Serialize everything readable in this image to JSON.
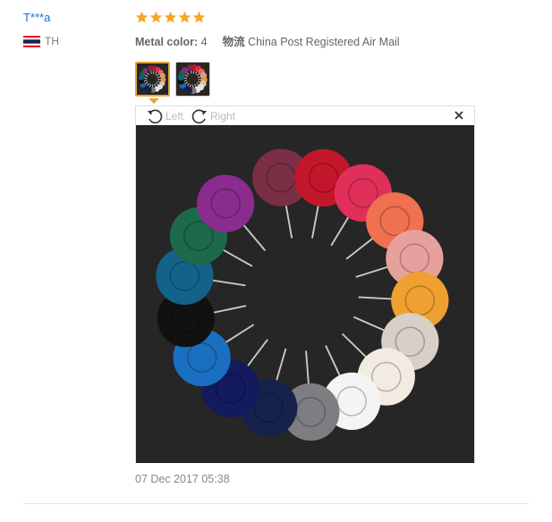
{
  "reviewer": {
    "name": "T***a",
    "country": "TH",
    "flag_icon": "thailand-flag-icon"
  },
  "rating": {
    "stars": 5,
    "max": 5,
    "color": "#f5a623"
  },
  "meta": {
    "color_label": "Metal color:",
    "color_value": "4",
    "shipping_label": "物流",
    "shipping_value": "China Post Registered Air Mail"
  },
  "thumbnails": [
    {
      "name": "photo-1",
      "selected": true
    },
    {
      "name": "photo-2",
      "selected": false
    }
  ],
  "viewer": {
    "rotate_left_label": "Left",
    "rotate_right_label": "Right",
    "close_icon": "close-icon"
  },
  "photo": {
    "description_icon": "rose-lapel-pins-photo",
    "flower_colors": [
      "#7b2f45",
      "#c4162a",
      "#e0305a",
      "#f07050",
      "#e7a19c",
      "#f0a030",
      "#d8cfc6",
      "#f2ebe2",
      "#f4f4f4",
      "#7e7e82",
      "#16224a",
      "#131a5e",
      "#1b6fc0",
      "#111111",
      "#13628a",
      "#1c6a4a",
      "#8a2c8e"
    ]
  },
  "date": "07 Dec 2017 05:38"
}
